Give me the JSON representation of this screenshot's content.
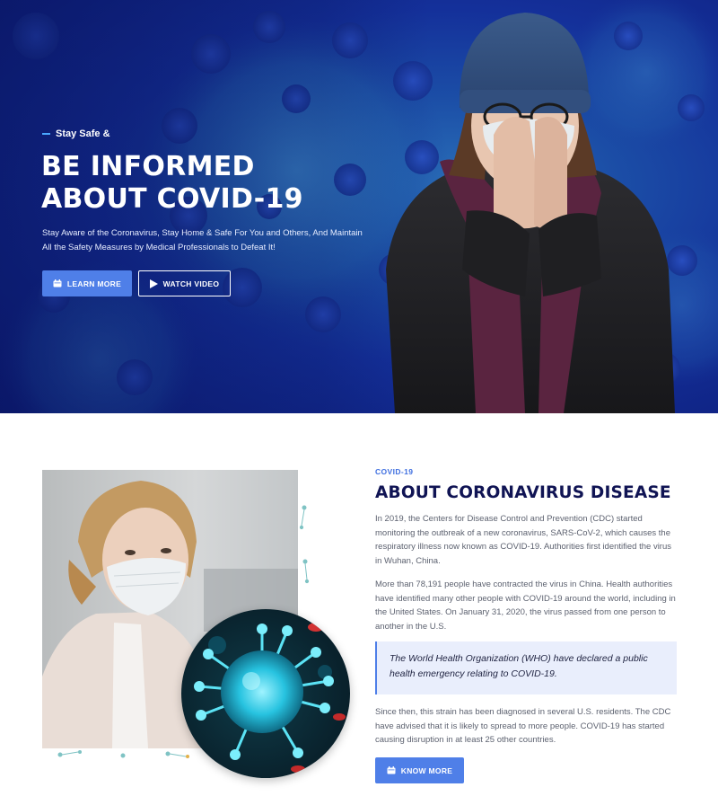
{
  "hero": {
    "eyebrow": "Stay Safe &",
    "title_line1": "BE INFORMED",
    "title_line2": "ABOUT COVID-19",
    "subtitle": "Stay Aware of the Coronavirus, Stay Home & Safe For You and Others, And Maintain All the Safety Measures by Medical Professionals to Defeat It!",
    "learn_more_label": "LEARN MORE",
    "learn_more_icon": "calendar-icon",
    "watch_video_label": "WATCH VIDEO",
    "watch_video_icon": "play-icon"
  },
  "about": {
    "tag": "COVID-19",
    "title": "ABOUT CORONAVIRUS DISEASE",
    "paragraph1": "In 2019, the Centers for Disease Control and Prevention (CDC) started monitoring the outbreak of a new coronavirus, SARS-CoV-2, which causes the respiratory illness now known as COVID-19. Authorities first identified the virus in Wuhan, China.",
    "paragraph2": "More than 78,191 people have contracted the virus in China. Health authorities have identified many other people with COVID-19 around the world, including in the United States. On January 31, 2020, the virus passed from one person to another in the U.S.",
    "quote": "The World Health Organization (WHO) have declared a public health emergency relating to COVID-19.",
    "paragraph3": "Since then, this strain has been diagnosed in several U.S. residents. The CDC have advised that it is likely to spread to more people. COVID-19 has started causing disruption in at least 25 other countries.",
    "know_more_label": "KNOW MORE",
    "know_more_icon": "calendar-icon"
  },
  "colors": {
    "accent": "#4f7fe8",
    "hero_bg": "#14309a",
    "title_dark": "#101454",
    "tag_blue": "#3f6fe0"
  }
}
